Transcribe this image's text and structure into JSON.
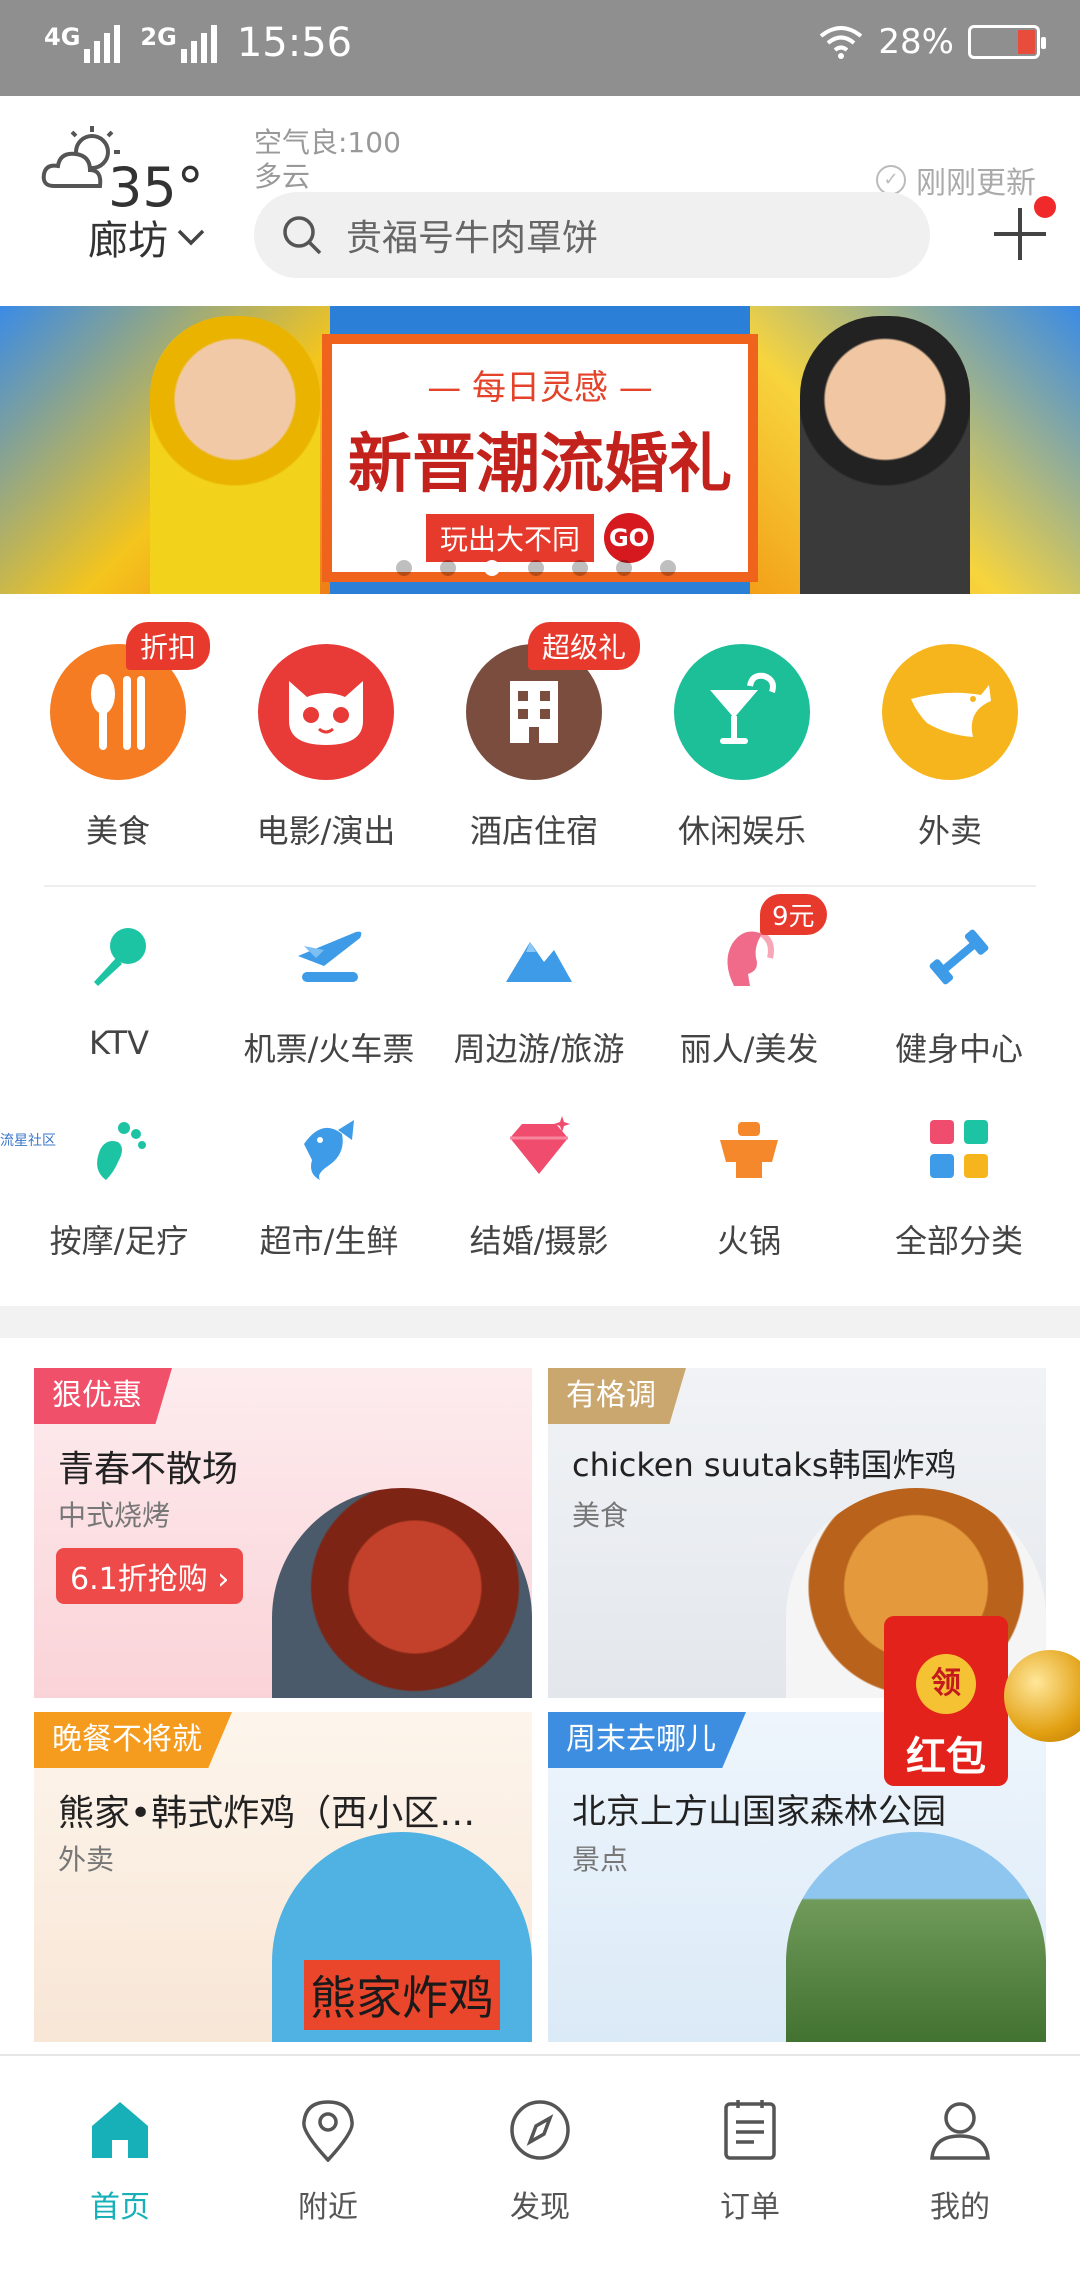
{
  "status_bar": {
    "network1": "4G",
    "network2": "2G",
    "time": "15:56",
    "battery": "28%",
    "battery_level": 0.28
  },
  "header": {
    "temperature": "35°",
    "air_quality": "空气良:100",
    "weather": "多云",
    "city": "廊坊",
    "updated": "刚刚更新",
    "search_placeholder": "贵福号牛肉罩饼"
  },
  "banner": {
    "subtitle": "— 每日灵感 —",
    "title": "新晋潮流婚礼",
    "cta": "玩出大不同",
    "go": "GO",
    "page_count": 7,
    "active_page": 3
  },
  "categories_main": [
    {
      "label": "美食",
      "icon": "fork-knife-icon",
      "color": "#f57c22",
      "tag": "折扣"
    },
    {
      "label": "电影/演出",
      "icon": "cat-icon",
      "color": "#e83a36",
      "tag": ""
    },
    {
      "label": "酒店住宿",
      "icon": "building-icon",
      "color": "#7b4d3e",
      "tag": "超级礼"
    },
    {
      "label": "休闲娱乐",
      "icon": "cocktail-icon",
      "color": "#1cbf98",
      "tag": ""
    },
    {
      "label": "外卖",
      "icon": "delivery-rabbit-icon",
      "color": "#f7b51d",
      "tag": ""
    }
  ],
  "categories_sub": [
    {
      "label": "KTV",
      "icon": "microphone-icon",
      "color": "#1cc4a4"
    },
    {
      "label": "机票/火车票",
      "icon": "plane-icon",
      "color": "#3d9be8"
    },
    {
      "label": "周边游/旅游",
      "icon": "mountain-icon",
      "color": "#3d9be8"
    },
    {
      "label": "丽人/美发",
      "icon": "beauty-head-icon",
      "color": "#f06b8a",
      "tag": "9元"
    },
    {
      "label": "健身中心",
      "icon": "dumbbell-icon",
      "color": "#3d9be8"
    },
    {
      "label": "按摩/足疗",
      "icon": "foot-icon",
      "color": "#1cc4a4"
    },
    {
      "label": "超市/生鲜",
      "icon": "fish-icon",
      "color": "#3d9be8"
    },
    {
      "label": "结婚/摄影",
      "icon": "diamond-icon",
      "color": "#f04d6e"
    },
    {
      "label": "火锅",
      "icon": "hotpot-icon",
      "color": "#f5882a"
    },
    {
      "label": "全部分类",
      "icon": "grid-icon",
      "color": "#f04d6e"
    }
  ],
  "tiny_label": "流星社区",
  "promos": [
    {
      "flag": "狠优惠",
      "flag_color": "#f0506a",
      "title": "青春不散场",
      "category": "中式烧烤",
      "button": "6.1折抢购 ›",
      "bg": "#fde5e8",
      "img_color": "#a3321f"
    },
    {
      "flag": "有格调",
      "flag_color": "#c9a76f",
      "title": "chicken suutaks韩国炸鸡",
      "category": "美食",
      "button": "",
      "bg": "#eef1f4",
      "img_color": "#d9781e"
    },
    {
      "flag": "晚餐不将就",
      "flag_color": "#f59b1d",
      "title": "熊家•韩式炸鸡（西小区…",
      "category": "外卖",
      "button": "",
      "bg": "#fbf1e8",
      "img_color": "#4fb2e3"
    },
    {
      "flag": "周末去哪儿",
      "flag_color": "#3d8de0",
      "title": "北京上方山国家森林公园",
      "category": "景点",
      "button": "",
      "bg": "#eaf3fb",
      "img_color": "#4f8f3a"
    }
  ],
  "promo_image_text": "熊家炸鸡",
  "red_packet": {
    "seal": "领",
    "text": "红包"
  },
  "bottom_nav": [
    {
      "label": "首页",
      "icon": "home-icon",
      "active": true
    },
    {
      "label": "附近",
      "icon": "location-pin-icon",
      "active": false
    },
    {
      "label": "发现",
      "icon": "compass-icon",
      "active": false
    },
    {
      "label": "订单",
      "icon": "order-list-icon",
      "active": false
    },
    {
      "label": "我的",
      "icon": "user-icon",
      "active": false
    }
  ],
  "colors": {
    "accent": "#17b0b8",
    "status_bar": "#8f8f8f"
  }
}
